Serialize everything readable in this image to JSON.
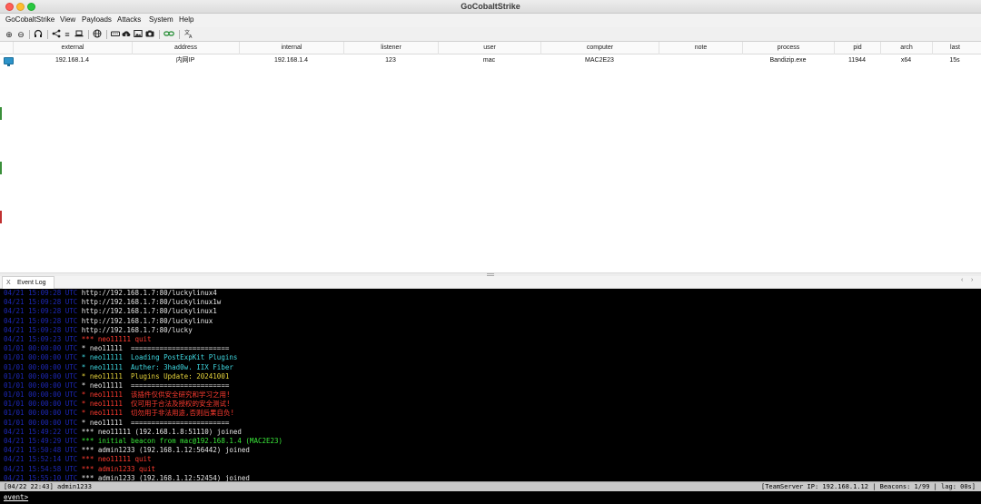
{
  "window": {
    "title": "GoCobaltStrike"
  },
  "menu": [
    "GoCobaltStrike",
    "View",
    "Payloads",
    "Attacks",
    "System",
    "Help"
  ],
  "toolbar_icons": [
    "plus-circle-icon",
    "minus-circle-icon",
    "headphones-icon",
    "share-icon",
    "list-icon",
    "laptop-icon",
    "globe-icon",
    "keyboard-icon",
    "cloud-download-icon",
    "picture-icon",
    "camera-icon",
    "link-icon",
    "translate-icon"
  ],
  "table": {
    "columns": [
      "external",
      "address",
      "internal",
      "listener",
      "user",
      "computer",
      "note",
      "process",
      "pid",
      "arch",
      "last"
    ],
    "rows": [
      {
        "external": "192.168.1.4",
        "address": "内网IP",
        "internal": "192.168.1.4",
        "listener": "123",
        "user": "mac",
        "computer": "MAC2E23",
        "note": "",
        "process": "Bandizip.exe",
        "pid": "11944",
        "arch": "x64",
        "last": "15s"
      }
    ]
  },
  "tab": {
    "label": "Event Log",
    "close": "X"
  },
  "event_log": [
    {
      "ts": "04/21 15:09:28 UTC",
      "text": "http://192.168.1.7:80/luckylinux4",
      "color": "white"
    },
    {
      "ts": "04/21 15:09:28 UTC",
      "text": "http://192.168.1.7:80/luckylinux1w",
      "color": "white"
    },
    {
      "ts": "04/21 15:09:28 UTC",
      "text": "http://192.168.1.7:80/luckylinux1",
      "color": "white"
    },
    {
      "ts": "04/21 15:09:28 UTC",
      "text": "http://192.168.1.7:80/luckylinux",
      "color": "white"
    },
    {
      "ts": "04/21 15:09:28 UTC",
      "text": "http://192.168.1.7:80/lucky",
      "color": "white"
    },
    {
      "ts": "04/21 15:09:23 UTC",
      "text": "*** neo11111 quit",
      "color": "red"
    },
    {
      "ts": "01/01 00:00:00 UTC",
      "text": "* neo11111  ========================",
      "color": "white"
    },
    {
      "ts": "01/01 00:00:00 UTC",
      "text": "* neo11111  Loading PostExpKit Plugins",
      "color": "cyan"
    },
    {
      "ts": "01/01 00:00:00 UTC",
      "text": "* neo11111  Auther: 3had0w. IIX Fiber",
      "color": "cyan"
    },
    {
      "ts": "01/01 00:00:00 UTC",
      "text": "* neo11111  Plugins Update: 20241001",
      "color": "yellow"
    },
    {
      "ts": "01/01 00:00:00 UTC",
      "text": "* neo11111  ========================",
      "color": "white"
    },
    {
      "ts": "01/01 00:00:00 UTC",
      "text": "* neo11111  该插件仅供安全研究和学习之用!",
      "color": "red"
    },
    {
      "ts": "01/01 00:00:00 UTC",
      "text": "* neo11111  仅可用于合法及授权的安全测试!",
      "color": "red"
    },
    {
      "ts": "01/01 00:00:00 UTC",
      "text": "* neo11111  切勿用于非法用途,否则后果自负!",
      "color": "red"
    },
    {
      "ts": "01/01 00:00:00 UTC",
      "text": "* neo11111  ========================",
      "color": "white"
    },
    {
      "ts": "04/21 15:49:22 UTC",
      "text": "*** neo11111 (192.168.1.8:51110) joined",
      "color": "white"
    },
    {
      "ts": "04/21 15:49:29 UTC",
      "text": "*** initial beacon from mac@192.168.1.4 (MAC2E23)",
      "color": "green"
    },
    {
      "ts": "04/21 15:50:48 UTC",
      "text": "*** admin1233 (192.168.1.12:56442) joined",
      "color": "white"
    },
    {
      "ts": "04/21 15:52:14 UTC",
      "text": "*** neo11111 quit",
      "color": "red"
    },
    {
      "ts": "04/21 15:54:58 UTC",
      "text": "*** admin1233 quit",
      "color": "red"
    },
    {
      "ts": "04/21 15:55:10 UTC",
      "text": "*** admin1233 (192.168.1.12:52454) joined",
      "color": "white"
    }
  ],
  "statusbar": {
    "left": "[04/22 22:43] admin1233",
    "right": "[TeamServer IP: 192.168.1.12 | Beacons: 1/99 | lag: 00s]"
  },
  "input": {
    "prompt": "event>",
    "value": ""
  }
}
